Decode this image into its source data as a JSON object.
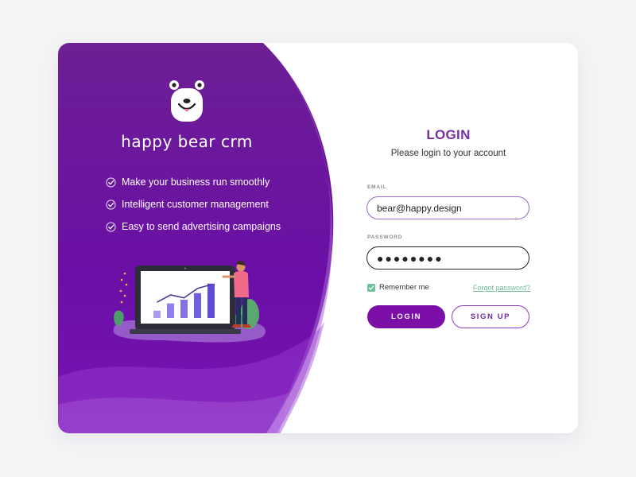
{
  "brand": {
    "name": "happy bear crm",
    "logo_icon": "bear-face-icon"
  },
  "features": [
    {
      "label": "Make your business run smoothly",
      "icon": "check-circle-icon"
    },
    {
      "label": "Intelligent customer management",
      "icon": "check-circle-icon"
    },
    {
      "label": "Easy to send advertising campaigns",
      "icon": "check-circle-icon"
    }
  ],
  "illustration": {
    "chart_data": {
      "type": "bar",
      "values": [
        1,
        2,
        2.5,
        3.4,
        4.7
      ],
      "trend": [
        1.5,
        2.5,
        2.1,
        3.4,
        3.9
      ]
    }
  },
  "login": {
    "title": "LOGIN",
    "subtitle": "Please login to your account",
    "email_label": "EMAIL",
    "email_value": "bear@happy.design",
    "password_label": "PASSWORD",
    "password_value": "●●●●●●●●",
    "remember_label": "Remember me",
    "remember_checked": true,
    "forgot_label": "Forgot password?",
    "login_button": "LOGIN",
    "signup_button": "SIGN UP"
  },
  "colors": {
    "primary_purple": "#7b0fa8",
    "accent_green": "#6fbf9a",
    "title_purple": "#7a2fa0"
  }
}
